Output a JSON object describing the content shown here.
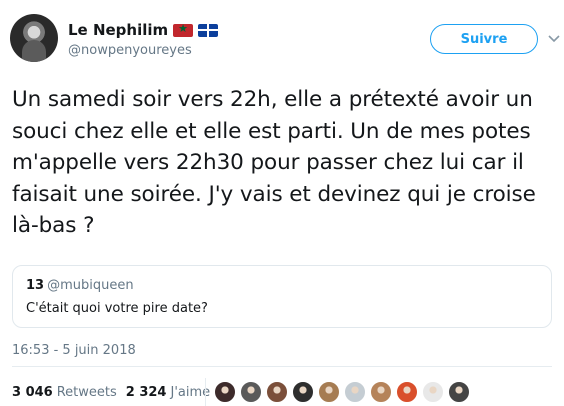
{
  "author": {
    "display_name": "Le Nephilim",
    "handle": "@nowpenyoureyes",
    "flags": [
      "flag-morocco-icon",
      "flag-quebec-icon"
    ]
  },
  "follow_label": "Suivre",
  "tweet": {
    "text": "Un samedi soir vers 22h, elle a prétexté avoir un souci chez elle et elle est parti. Un de mes potes m'appelle vers 22h30 pour passer chez lui car il faisait une soirée. J'y vais et devinez qui je croise là-bas ?"
  },
  "quoted_tweet": {
    "name": "13",
    "handle": "@mubiqueen",
    "text": "C'était quoi votre pire date?"
  },
  "timestamp": "16:53 - 5 juin 2018",
  "stats": {
    "retweets_count": "3 046",
    "retweets_label": "Retweets",
    "likes_count": "2 324",
    "likes_label": "J'aime"
  },
  "likers": [
    {
      "icon": "liker-avatar-icon",
      "color": "#3d2b2b"
    },
    {
      "icon": "liker-avatar-icon",
      "color": "#5a5a5a"
    },
    {
      "icon": "liker-avatar-icon",
      "color": "#7b4f3a"
    },
    {
      "icon": "liker-avatar-icon",
      "color": "#2e2e2e"
    },
    {
      "icon": "liker-avatar-icon",
      "color": "#a67c52"
    },
    {
      "icon": "liker-avatar-icon",
      "color": "#c5cdd3"
    },
    {
      "icon": "liker-avatar-icon",
      "color": "#b5835a"
    },
    {
      "icon": "liker-avatar-icon",
      "color": "#d94f2b"
    },
    {
      "icon": "liker-avatar-icon",
      "color": "#e8e8e8"
    },
    {
      "icon": "liker-avatar-icon",
      "color": "#444444"
    }
  ],
  "colors": {
    "accent": "#1da1f2",
    "text": "#14171a",
    "muted": "#657786",
    "border": "#e1e8ed"
  }
}
